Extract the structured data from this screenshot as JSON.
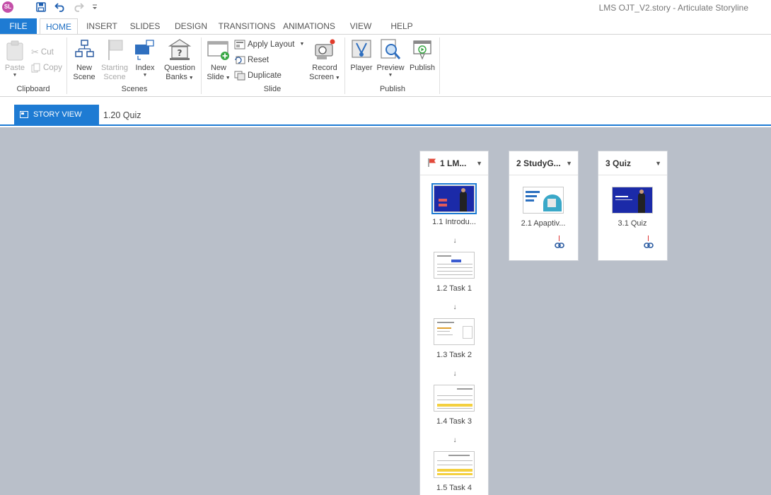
{
  "app": {
    "logo": "SL",
    "window_title": "LMS OJT_V2.story -  Articulate Storyline"
  },
  "quick_access": [
    "save-icon",
    "undo-icon",
    "redo-icon",
    "customize-icon"
  ],
  "tabs": [
    "FILE",
    "HOME",
    "INSERT",
    "SLIDES",
    "DESIGN",
    "TRANSITIONS",
    "ANIMATIONS",
    "VIEW",
    "HELP"
  ],
  "ribbon": {
    "clipboard": {
      "label": "Clipboard",
      "paste": "Paste",
      "cut": "Cut",
      "copy": "Copy"
    },
    "scenes": {
      "label": "Scenes",
      "new_scene_1": "New",
      "new_scene_2": "Scene",
      "starting_scene_1": "Starting",
      "starting_scene_2": "Scene",
      "index": "Index",
      "question_banks_1": "Question",
      "question_banks_2": "Banks"
    },
    "slide": {
      "label": "Slide",
      "new_slide_1": "New",
      "new_slide_2": "Slide",
      "apply_layout": "Apply Layout",
      "reset": "Reset",
      "duplicate": "Duplicate",
      "record_screen_1": "Record",
      "record_screen_2": "Screen"
    },
    "publish": {
      "label": "Publish",
      "player": "Player",
      "preview": "Preview",
      "publish": "Publish"
    }
  },
  "view": {
    "story_view_label": "STORY VIEW",
    "breadcrumb": "1.20 Quiz"
  },
  "scenes": [
    {
      "title": "1 LM...",
      "slides": [
        "1.1 Introdu...",
        "1.2 Task 1",
        "1.3 Task 2",
        "1.4 Task 3",
        "1.5 Task 4"
      ]
    },
    {
      "title": "2 StudyG...",
      "slides": [
        "2.1 Apaptiv..."
      ]
    },
    {
      "title": "3 Quiz",
      "slides": [
        "3.1 Quiz"
      ]
    }
  ],
  "colors": {
    "accent": "#1e7bd3",
    "canvas": "#b9bfc9",
    "thumb_navy": "#1b2aa8"
  }
}
